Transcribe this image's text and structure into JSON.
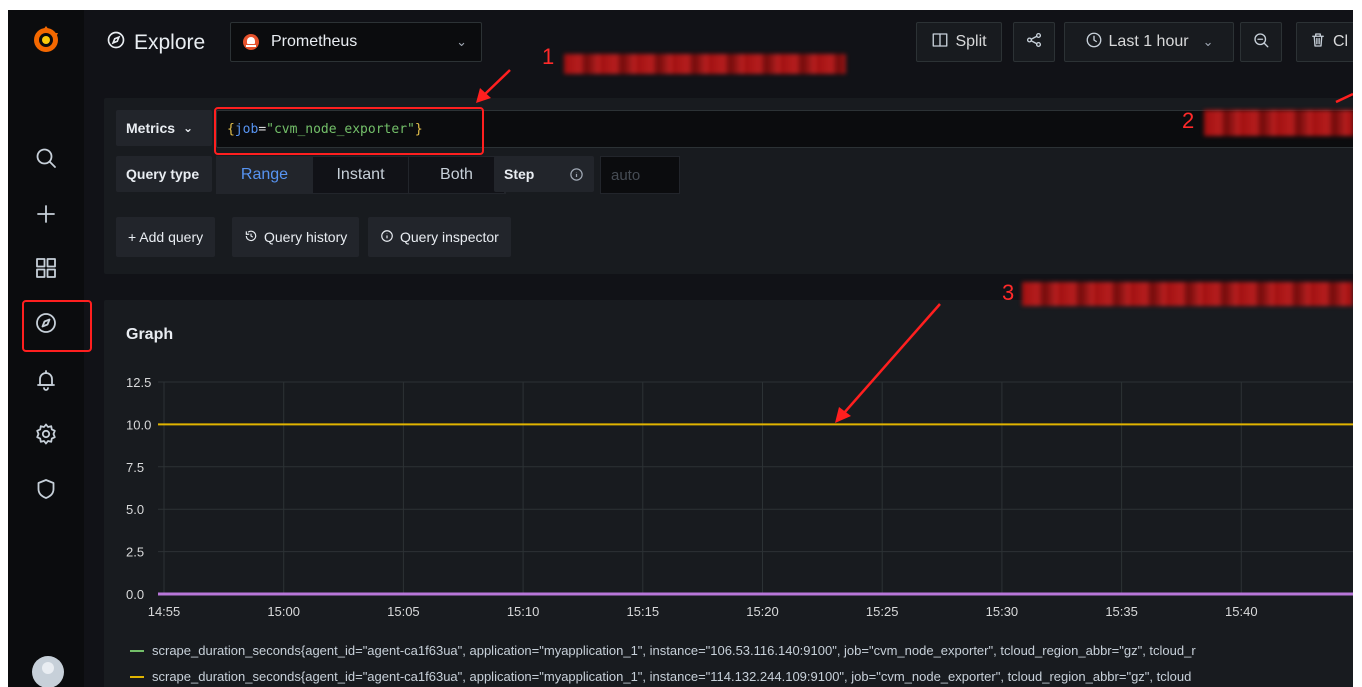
{
  "sidebar": {
    "logo_icon": "grafana-logo-icon",
    "items": [
      {
        "icon": "search-icon"
      },
      {
        "icon": "plus-icon"
      },
      {
        "icon": "dashboards-grid-icon"
      },
      {
        "icon": "compass-explore-icon",
        "active": true
      },
      {
        "icon": "bell-alert-icon"
      },
      {
        "icon": "gear-icon"
      },
      {
        "icon": "shield-icon"
      }
    ],
    "avatar_icon": "user-avatar-icon"
  },
  "topbar": {
    "title": "Explore",
    "datasource": "Prometheus",
    "split_label": "Split",
    "time_range_label": "Last 1 hour",
    "clear_label": "Cl"
  },
  "query": {
    "metrics_label": "Metrics",
    "expr_open": "{",
    "expr_key": "job",
    "expr_eq": "=",
    "expr_value": "\"cvm_node_exporter\"",
    "expr_close": "}",
    "query_type_label": "Query type",
    "query_types": [
      "Range",
      "Instant",
      "Both"
    ],
    "active_query_type": "Range",
    "step_label": "Step",
    "step_placeholder": "auto",
    "add_query_label": "+ Add query",
    "history_label": "Query history",
    "inspector_label": "Query inspector"
  },
  "graph": {
    "title": "Graph",
    "chart_data": {
      "type": "line",
      "x": [
        "14:55",
        "15:00",
        "15:05",
        "15:10",
        "15:15",
        "15:20",
        "15:25",
        "15:30",
        "15:35",
        "15:40",
        "15"
      ],
      "y_ticks": [
        "12.5",
        "10.0",
        "7.5",
        "5.0",
        "2.5",
        "0.0"
      ],
      "ylim": [
        0,
        12.5
      ],
      "grid": true,
      "series": [
        {
          "values": [
            10,
            10,
            10,
            10,
            10,
            10,
            10,
            10,
            10,
            10,
            10
          ],
          "color": "#e0b400"
        },
        {
          "values": [
            0,
            0,
            0,
            0,
            0,
            0,
            0,
            0,
            0,
            0,
            0
          ],
          "color": "#b877d9"
        }
      ]
    },
    "legend": [
      {
        "text": "scrape_duration_seconds{agent_id=\"agent-ca1f63ua\", application=\"myapplication_1\", instance=\"106.53.116.140:9100\", job=\"cvm_node_exporter\", tcloud_region_abbr=\"gz\", tcloud_r",
        "color": "#73bf69"
      },
      {
        "text": "scrape_duration_seconds{agent_id=\"agent-ca1f63ua\", application=\"myapplication_1\", instance=\"114.132.244.109:9100\", job=\"cvm_node_exporter\", tcloud_region_abbr=\"gz\", tcloud",
        "color": "#e0b400"
      }
    ]
  },
  "annotations": {
    "n1": "1",
    "n2": "2",
    "n3": "3",
    "color": "#ff1f1f"
  }
}
